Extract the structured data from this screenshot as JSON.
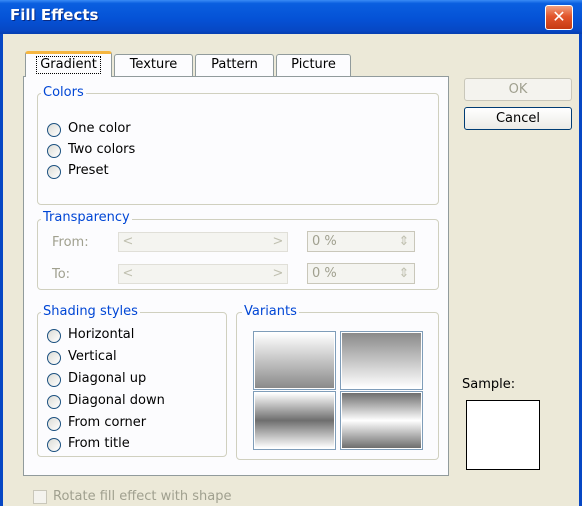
{
  "window": {
    "title": "Fill Effects",
    "close_glyph": "✕"
  },
  "tabs": [
    {
      "label": "Gradient",
      "selected": true
    },
    {
      "label": "Texture",
      "selected": false
    },
    {
      "label": "Pattern",
      "selected": false
    },
    {
      "label": "Picture",
      "selected": false
    }
  ],
  "colors_group": {
    "legend": "Colors",
    "options": [
      "One color",
      "Two colors",
      "Preset"
    ]
  },
  "transparency_group": {
    "legend": "Transparency",
    "from_label": "From:",
    "to_label": "To:",
    "from_value": "0 %",
    "to_value": "0 %",
    "arrow_left": "<",
    "arrow_right": ">",
    "spin_glyph": "⇕"
  },
  "shading_group": {
    "legend": "Shading styles",
    "options": [
      "Horizontal",
      "Vertical",
      "Diagonal up",
      "Diagonal down",
      "From corner",
      "From title"
    ]
  },
  "variants_group": {
    "legend": "Variants"
  },
  "buttons": {
    "ok": "OK",
    "cancel": "Cancel"
  },
  "sample": {
    "label": "Sample:"
  },
  "rotate": {
    "label": "Rotate fill effect with shape"
  }
}
